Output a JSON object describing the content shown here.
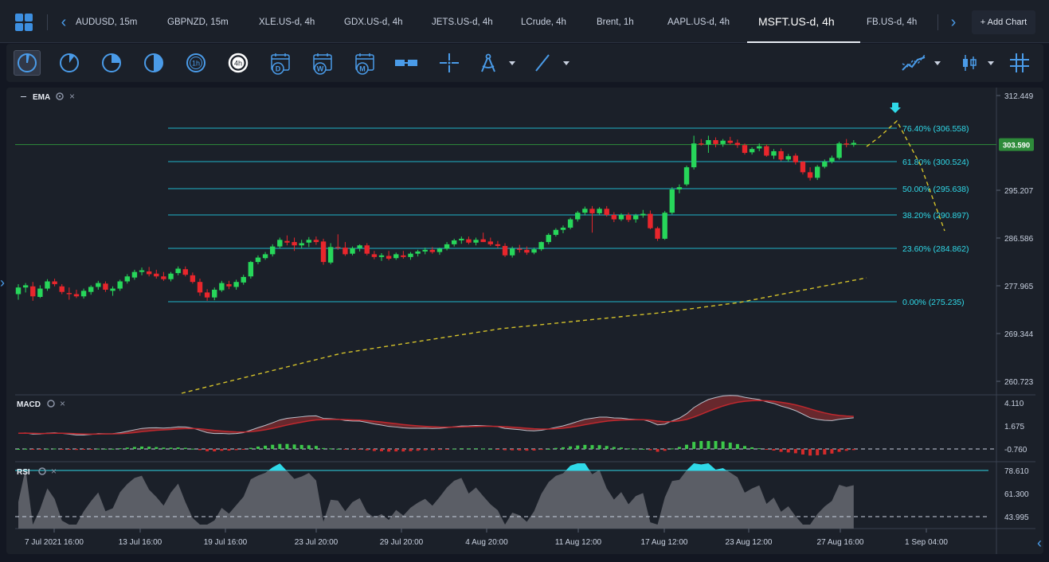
{
  "tabbar": {
    "tabs": [
      {
        "label": "AUDUSD, 15m",
        "active": false
      },
      {
        "label": "GBPNZD, 15m",
        "active": false
      },
      {
        "label": "XLE.US-d, 4h",
        "active": false
      },
      {
        "label": "GDX.US-d, 4h",
        "active": false
      },
      {
        "label": "JETS.US-d, 4h",
        "active": false
      },
      {
        "label": "LCrude, 4h",
        "active": false
      },
      {
        "label": "Brent, 1h",
        "active": false
      },
      {
        "label": "AAPL.US-d, 4h",
        "active": false
      },
      {
        "label": "MSFT.US-d, 4h",
        "active": true
      },
      {
        "label": "FB.US-d, 4h",
        "active": false
      }
    ],
    "add_chart_label": "+ Add Chart"
  },
  "toolbar": {
    "tools": [
      {
        "name": "timeframe-1m-icon",
        "label": ""
      },
      {
        "name": "timeframe-5m-icon",
        "label": ""
      },
      {
        "name": "timeframe-15m-icon",
        "label": ""
      },
      {
        "name": "timeframe-30m-icon",
        "label": ""
      },
      {
        "name": "timeframe-1h-icon",
        "label": "1h"
      },
      {
        "name": "timeframe-4h-icon",
        "label": "4h"
      },
      {
        "name": "timeframe-daily-icon",
        "label": "D"
      },
      {
        "name": "timeframe-weekly-icon",
        "label": "W"
      },
      {
        "name": "timeframe-monthly-icon",
        "label": "M"
      }
    ]
  },
  "indicators": {
    "main_label": "EMA",
    "macd_label": "MACD",
    "rsi_label": "RSI"
  },
  "chart_data": {
    "type": "candlestick",
    "symbol": "MSFT.US-d",
    "timeframe": "4h",
    "current_price": "303.590",
    "price_axis_ticks": [
      "312.449",
      "295.207",
      "286.586",
      "277.965",
      "269.344",
      "260.723"
    ],
    "macd_axis_ticks": [
      "4.110",
      "1.675",
      "-0.760"
    ],
    "rsi_axis_ticks": [
      "78.610",
      "61.300",
      "43.995"
    ],
    "time_axis_ticks": [
      "7 Jul 2021 16:00",
      "13 Jul 16:00",
      "19 Jul 16:00",
      "23 Jul 20:00",
      "29 Jul 20:00",
      "4 Aug 20:00",
      "11 Aug 12:00",
      "17 Aug 12:00",
      "23 Aug 12:00",
      "27 Aug 16:00",
      "1 Sep 04:00"
    ],
    "fibonacci": [
      {
        "label": "76.40% (306.558)",
        "price": 306.558
      },
      {
        "label": "61.80% (300.524)",
        "price": 300.524
      },
      {
        "label": "50.00% (295.638)",
        "price": 295.638
      },
      {
        "label": "38.20% (290.897)",
        "price": 290.897
      },
      {
        "label": "23.60% (284.862)",
        "price": 284.862
      },
      {
        "label": "0.00% (275.235)",
        "price": 275.235
      }
    ],
    "candles": [
      [
        276.6,
        278.4,
        275.6,
        277.8
      ],
      [
        277.8,
        278.6,
        276.9,
        278.2
      ],
      [
        278.0,
        278.8,
        275.4,
        276.2
      ],
      [
        276.1,
        278.2,
        275.9,
        277.6
      ],
      [
        277.6,
        279.3,
        277.2,
        278.9
      ],
      [
        278.9,
        279.4,
        278.0,
        278.4
      ],
      [
        278.0,
        278.4,
        276.6,
        277.0
      ],
      [
        276.8,
        277.8,
        275.6,
        276.6
      ],
      [
        276.6,
        277.4,
        275.9,
        276.2
      ],
      [
        276.2,
        277.6,
        275.8,
        277.2
      ],
      [
        277.0,
        278.2,
        276.5,
        277.9
      ],
      [
        277.9,
        279.0,
        277.4,
        278.6
      ],
      [
        278.5,
        278.9,
        277.0,
        277.4
      ],
      [
        277.2,
        278.0,
        276.3,
        277.6
      ],
      [
        277.6,
        279.2,
        277.2,
        278.9
      ],
      [
        278.9,
        280.2,
        278.5,
        279.8
      ],
      [
        279.6,
        281.0,
        279.2,
        280.6
      ],
      [
        280.6,
        281.4,
        280.0,
        280.9
      ],
      [
        280.7,
        281.5,
        279.8,
        280.2
      ],
      [
        280.3,
        281.0,
        279.4,
        279.8
      ],
      [
        279.8,
        280.6,
        279.0,
        279.3
      ],
      [
        279.3,
        280.6,
        278.9,
        280.3
      ],
      [
        280.4,
        281.6,
        280.0,
        281.2
      ],
      [
        281.1,
        281.6,
        279.8,
        280.1
      ],
      [
        280.0,
        280.5,
        278.5,
        278.8
      ],
      [
        278.8,
        279.4,
        276.3,
        276.9
      ],
      [
        276.9,
        277.5,
        275.4,
        276.0
      ],
      [
        276.0,
        277.8,
        275.5,
        277.4
      ],
      [
        277.3,
        279.0,
        277.0,
        278.6
      ],
      [
        278.4,
        279.0,
        277.5,
        278.0
      ],
      [
        277.9,
        279.2,
        277.4,
        278.8
      ],
      [
        278.7,
        280.1,
        278.3,
        279.7
      ],
      [
        279.8,
        282.6,
        279.4,
        282.4
      ],
      [
        282.4,
        283.6,
        282.0,
        283.2
      ],
      [
        283.1,
        284.2,
        282.8,
        283.8
      ],
      [
        283.8,
        285.6,
        283.4,
        285.2
      ],
      [
        285.2,
        286.8,
        284.8,
        286.4
      ],
      [
        286.2,
        287.2,
        285.4,
        285.9
      ],
      [
        286.0,
        286.8,
        284.4,
        285.4
      ],
      [
        285.4,
        286.4,
        284.8,
        285.8
      ],
      [
        285.9,
        286.9,
        285.1,
        286.4
      ],
      [
        286.4,
        287.0,
        285.5,
        286.0
      ],
      [
        286.1,
        286.6,
        281.9,
        282.4
      ],
      [
        282.3,
        285.8,
        282.0,
        285.1
      ],
      [
        285.1,
        287.4,
        284.6,
        285.0
      ],
      [
        285.0,
        286.0,
        283.5,
        283.8
      ],
      [
        283.9,
        285.2,
        283.6,
        284.9
      ],
      [
        284.9,
        285.6,
        284.3,
        285.4
      ],
      [
        285.4,
        285.8,
        283.6,
        283.9
      ],
      [
        283.8,
        284.4,
        282.9,
        283.3
      ],
      [
        283.3,
        284.0,
        282.6,
        283.6
      ],
      [
        283.5,
        284.4,
        282.7,
        283.0
      ],
      [
        283.1,
        284.1,
        282.8,
        283.8
      ],
      [
        283.6,
        284.4,
        283.0,
        283.3
      ],
      [
        283.3,
        284.2,
        282.8,
        283.9
      ],
      [
        283.9,
        284.6,
        283.4,
        284.3
      ],
      [
        284.3,
        285.0,
        283.8,
        284.6
      ],
      [
        284.6,
        285.1,
        283.9,
        284.2
      ],
      [
        284.2,
        285.0,
        283.7,
        284.8
      ],
      [
        284.8,
        286.0,
        284.5,
        285.6
      ],
      [
        285.6,
        286.6,
        285.2,
        286.3
      ],
      [
        286.3,
        287.0,
        285.7,
        286.6
      ],
      [
        286.5,
        287.0,
        285.6,
        285.9
      ],
      [
        285.9,
        286.8,
        285.4,
        286.4
      ],
      [
        286.5,
        287.7,
        286.0,
        286.0
      ],
      [
        286.1,
        286.8,
        285.3,
        285.6
      ],
      [
        285.6,
        286.2,
        284.9,
        285.3
      ],
      [
        285.3,
        285.8,
        283.3,
        283.6
      ],
      [
        283.6,
        285.2,
        283.2,
        284.8
      ],
      [
        284.8,
        285.5,
        284.1,
        284.6
      ],
      [
        284.6,
        285.2,
        283.7,
        284.1
      ],
      [
        284.1,
        285.0,
        283.8,
        284.7
      ],
      [
        284.7,
        286.1,
        284.4,
        286.0
      ],
      [
        286.0,
        287.6,
        285.6,
        287.3
      ],
      [
        287.3,
        288.5,
        287.0,
        288.2
      ],
      [
        288.2,
        289.0,
        287.6,
        288.6
      ],
      [
        288.6,
        290.4,
        288.3,
        290.1
      ],
      [
        290.1,
        291.6,
        289.7,
        291.3
      ],
      [
        291.3,
        292.4,
        290.8,
        292.0
      ],
      [
        292.0,
        292.5,
        287.7,
        291.2
      ],
      [
        291.2,
        292.3,
        290.9,
        292.0
      ],
      [
        292.0,
        292.5,
        290.6,
        290.9
      ],
      [
        290.9,
        291.4,
        289.6,
        290.1
      ],
      [
        290.1,
        291.2,
        289.8,
        290.9
      ],
      [
        290.9,
        291.3,
        289.6,
        290.0
      ],
      [
        290.1,
        291.1,
        289.5,
        290.8
      ],
      [
        290.8,
        291.8,
        290.4,
        291.1
      ],
      [
        291.1,
        291.7,
        288.3,
        288.5
      ],
      [
        288.5,
        288.8,
        286.2,
        286.6
      ],
      [
        286.6,
        291.6,
        286.4,
        291.3
      ],
      [
        291.3,
        295.9,
        291.0,
        295.5
      ],
      [
        295.5,
        296.4,
        294.8,
        295.9
      ],
      [
        296.4,
        299.8,
        296.1,
        299.5
      ],
      [
        299.5,
        305.2,
        299.1,
        303.8
      ],
      [
        303.8,
        304.6,
        303.4,
        303.6
      ],
      [
        303.6,
        305.2,
        302.1,
        304.4
      ],
      [
        304.4,
        304.9,
        303.1,
        303.7
      ],
      [
        303.7,
        304.6,
        303.2,
        304.3
      ],
      [
        304.3,
        305.0,
        303.6,
        303.9
      ],
      [
        303.9,
        304.5,
        303.0,
        303.5
      ],
      [
        303.5,
        303.8,
        301.8,
        302.1
      ],
      [
        302.2,
        303.1,
        301.8,
        302.8
      ],
      [
        302.9,
        303.8,
        302.4,
        303.3
      ],
      [
        303.3,
        303.6,
        301.4,
        301.6
      ],
      [
        301.6,
        302.8,
        301.0,
        302.4
      ],
      [
        302.4,
        302.9,
        300.6,
        300.9
      ],
      [
        300.9,
        301.9,
        300.5,
        301.5
      ],
      [
        301.6,
        302.0,
        300.0,
        300.4
      ],
      [
        300.5,
        300.6,
        298.2,
        298.6
      ],
      [
        298.6,
        299.5,
        297.1,
        297.6
      ],
      [
        297.6,
        299.9,
        297.2,
        299.6
      ],
      [
        299.6,
        300.9,
        299.3,
        300.5
      ],
      [
        300.5,
        301.6,
        300.2,
        301.2
      ],
      [
        301.2,
        304.1,
        300.9,
        303.8
      ],
      [
        303.8,
        304.6,
        303.1,
        303.6
      ],
      [
        303.6,
        304.4,
        303.2,
        303.9
      ]
    ]
  }
}
